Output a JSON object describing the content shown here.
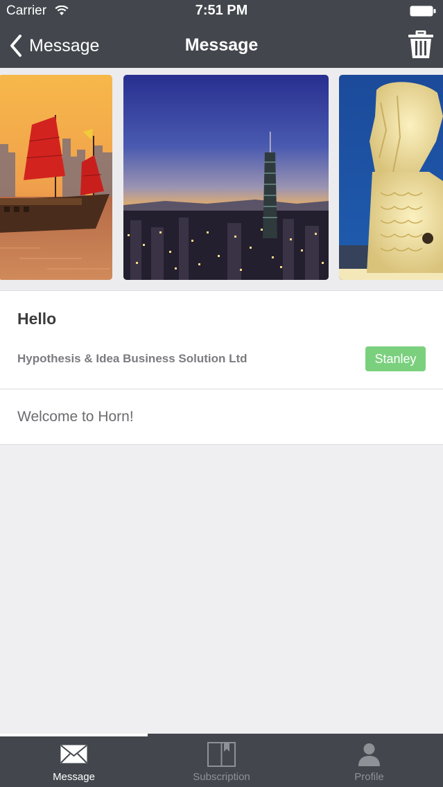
{
  "status_bar": {
    "carrier": "Carrier",
    "time": "7:51 PM",
    "icons": [
      "wifi-icon",
      "battery-icon"
    ]
  },
  "nav_bar": {
    "back_label": "Message",
    "title": "Message",
    "back_icon": "chevron-left-icon",
    "action_icon": "trash-icon"
  },
  "carousel": {
    "slides": [
      {
        "name": "junk-boat-harbor-photo"
      },
      {
        "name": "city-skyline-tower-photo"
      },
      {
        "name": "merlion-statue-photo"
      }
    ]
  },
  "message": {
    "title": "Hello",
    "company": "Hypothesis & Idea Business Solution Ltd",
    "sender": "Stanley",
    "body": "Welcome to Horn!"
  },
  "tab_bar": {
    "active_index": 0,
    "tabs": [
      {
        "label": "Message",
        "icon": "envelope-icon"
      },
      {
        "label": "Subscription",
        "icon": "book-icon"
      },
      {
        "label": "Profile",
        "icon": "person-icon"
      }
    ]
  },
  "colors": {
    "bar_background": "#43474d",
    "badge_green": "#7bd07e",
    "page_background": "#efeff1"
  }
}
